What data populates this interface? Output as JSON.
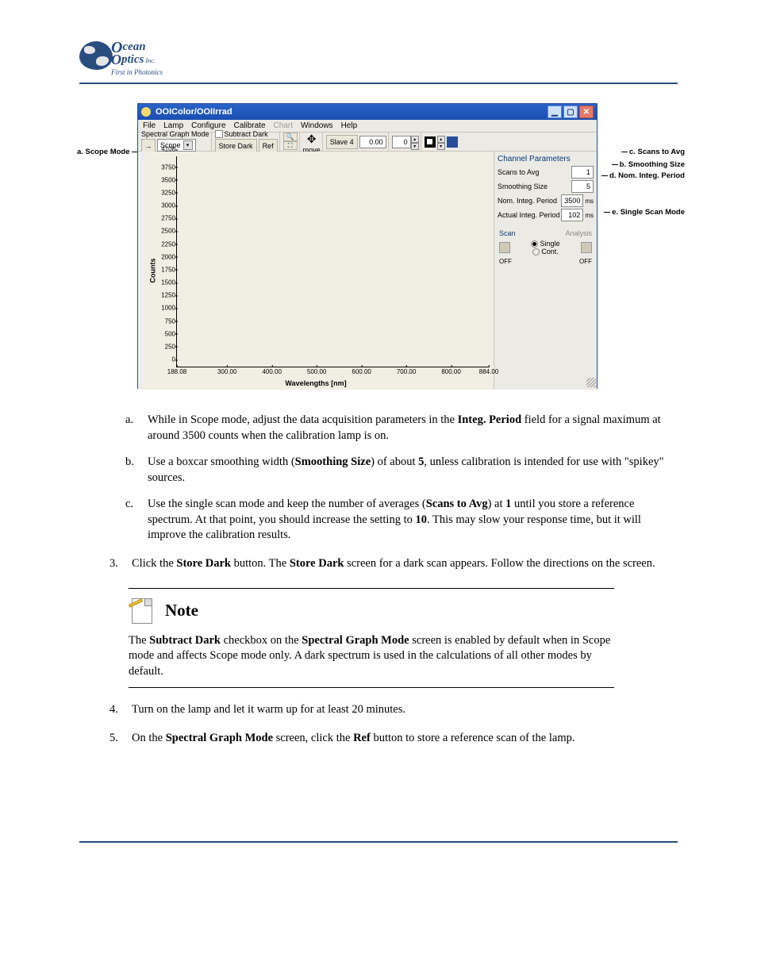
{
  "logo": {
    "line1": "cean",
    "line2": "ptics",
    "sub": "Inc.",
    "tag": "First in Photonics"
  },
  "callouts": {
    "a": "a. Scope Mode",
    "b": "b. Smoothing Size",
    "c": "c. Scans to Avg",
    "d": "d. Nom. Integ. Period",
    "e": "e. Single Scan Mode"
  },
  "app": {
    "title": "OOIColor/OOIIrrad",
    "menus": [
      "File",
      "Lamp",
      "Configure",
      "Calibrate",
      "Chart",
      "Windows",
      "Help"
    ],
    "disabled_menus": [
      "Chart"
    ],
    "toolbar": {
      "graph_mode_label": "Spectral Graph Mode",
      "scope_arrow": "→",
      "scope_value": "Scope",
      "subtract_dark": "Subtract Dark",
      "store_dark": "Store Dark",
      "ref": "Ref",
      "zoom": "🔍",
      "fullscreen": "⛶",
      "hand": "✥",
      "move": "move",
      "slave_label": "Slave 4",
      "slave_value": "0.00",
      "zero": "0"
    },
    "side": {
      "title": "Channel Parameters",
      "rows": [
        {
          "label": "Scans to Avg",
          "value": "1",
          "unit": ""
        },
        {
          "label": "Smoothing Size",
          "value": "5",
          "unit": ""
        },
        {
          "label": "Nom. Integ. Period",
          "value": "3500",
          "unit": "ms"
        },
        {
          "label": "Actual Integ. Period",
          "value": "102",
          "unit": "ms"
        }
      ],
      "scan": {
        "legend_left": "Scan",
        "legend_right": "Analysis",
        "single": "Single",
        "cont": "Cont.",
        "off": "OFF",
        "off2": "OFF"
      }
    }
  },
  "chart_data": {
    "type": "line",
    "title": "",
    "xlabel": "Wavelengths [nm]",
    "ylabel": "Counts",
    "yticks": [
      0,
      250,
      500,
      750,
      1000,
      1250,
      1500,
      1750,
      2000,
      2250,
      2500,
      2750,
      3000,
      3250,
      3500,
      3750,
      4100
    ],
    "xticks": [
      188.08,
      300.0,
      400.0,
      500.0,
      600.0,
      700.0,
      800.0,
      884.0
    ],
    "xlim": [
      188.08,
      884.0
    ],
    "ylim": [
      0,
      4100
    ],
    "series": []
  },
  "list_a": {
    "marker": "a.",
    "text_before": "While in Scope mode, adjust the data acquisition parameters in the ",
    "bold": "Integ. Period",
    "text_after": " field for a signal maximum at around 3500 counts when the calibration lamp is on."
  },
  "list_b": {
    "marker": "b.",
    "t1": "Use a boxcar smoothing width (",
    "b1": "Smoothing Size",
    "t2": ") of about ",
    "b2": "5",
    "t3": ", unless calibration is intended for use with \"spikey\" sources."
  },
  "list_c": {
    "marker": "c.",
    "t1": "Use the single scan mode and keep the number of averages (",
    "b1": "Scans to Avg",
    "t2": ") at ",
    "b2": "1",
    "t3": " until you store a reference spectrum. At that point, you should increase the setting to ",
    "b3": "10",
    "t4": ". This may slow your response time, but it will improve the calibration results."
  },
  "step3": {
    "marker": "3.",
    "t1": "Click the ",
    "b1": "Store Dark",
    "t2": " button. The ",
    "b2": "Store Dark",
    "t3": " screen for a dark scan appears. Follow the directions on the screen."
  },
  "note": {
    "title": "Note",
    "t1": "The ",
    "b1": "Subtract Dark",
    "t2": " checkbox on the ",
    "b2": "Spectral Graph Mode",
    "t3": " screen is enabled by default when in Scope mode and affects Scope mode only. A dark spectrum is used in the calculations of all other modes by default."
  },
  "step4": {
    "marker": "4.",
    "text": "Turn on the lamp and let it warm up for at least 20 minutes."
  },
  "step5": {
    "marker": "5.",
    "t1": "On the ",
    "b1": "Spectral Graph Mode",
    "t2": " screen, click the ",
    "b2": "Ref",
    "t3": " button to store a reference scan of the lamp."
  }
}
